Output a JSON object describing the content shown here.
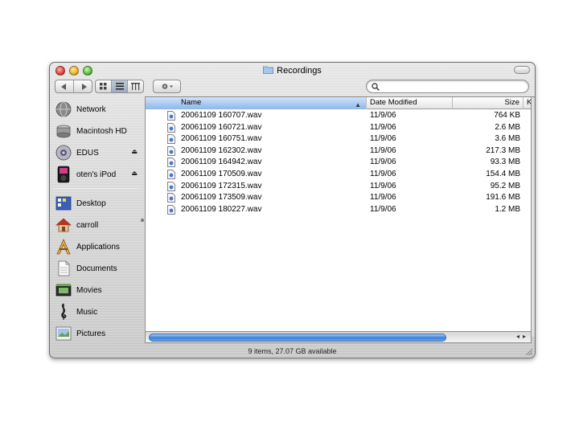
{
  "window": {
    "title": "Recordings"
  },
  "search": {
    "placeholder": "",
    "value": ""
  },
  "sidebar": {
    "devices": [
      {
        "label": "Network",
        "icon": "network-globe-icon"
      },
      {
        "label": "Macintosh HD",
        "icon": "hard-drive-icon"
      },
      {
        "label": "EDUS",
        "icon": "disk-icon",
        "eject": true
      },
      {
        "label": "oten's iPod",
        "icon": "ipod-icon",
        "eject": true
      }
    ],
    "places": [
      {
        "label": "Desktop",
        "icon": "desktop-icon"
      },
      {
        "label": "carroll",
        "icon": "home-icon"
      },
      {
        "label": "Applications",
        "icon": "applications-icon"
      },
      {
        "label": "Documents",
        "icon": "documents-icon"
      },
      {
        "label": "Movies",
        "icon": "movies-icon"
      },
      {
        "label": "Music",
        "icon": "music-icon"
      },
      {
        "label": "Pictures",
        "icon": "pictures-icon"
      }
    ]
  },
  "columns": {
    "name": "Name",
    "date": "Date Modified",
    "size": "Size",
    "kind": "Ki"
  },
  "files": [
    {
      "name": "20061109 160707.wav",
      "date": "11/9/06",
      "size": "764 KB"
    },
    {
      "name": "20061109 160721.wav",
      "date": "11/9/06",
      "size": "2.6 MB"
    },
    {
      "name": "20061109 160751.wav",
      "date": "11/9/06",
      "size": "3.6 MB"
    },
    {
      "name": "20061109 162302.wav",
      "date": "11/9/06",
      "size": "217.3 MB"
    },
    {
      "name": "20061109 164942.wav",
      "date": "11/9/06",
      "size": "93.3 MB"
    },
    {
      "name": "20061109 170509.wav",
      "date": "11/9/06",
      "size": "154.4 MB"
    },
    {
      "name": "20061109 172315.wav",
      "date": "11/9/06",
      "size": "95.2 MB"
    },
    {
      "name": "20061109 173509.wav",
      "date": "11/9/06",
      "size": "191.6 MB"
    },
    {
      "name": "20061109 180227.wav",
      "date": "11/9/06",
      "size": "1.2 MB"
    }
  ],
  "status": {
    "text": "9 items, 27.07 GB available"
  },
  "colors": {
    "selection_blue": "#3d7fd6",
    "header_sorted": "#8fb6ec"
  }
}
